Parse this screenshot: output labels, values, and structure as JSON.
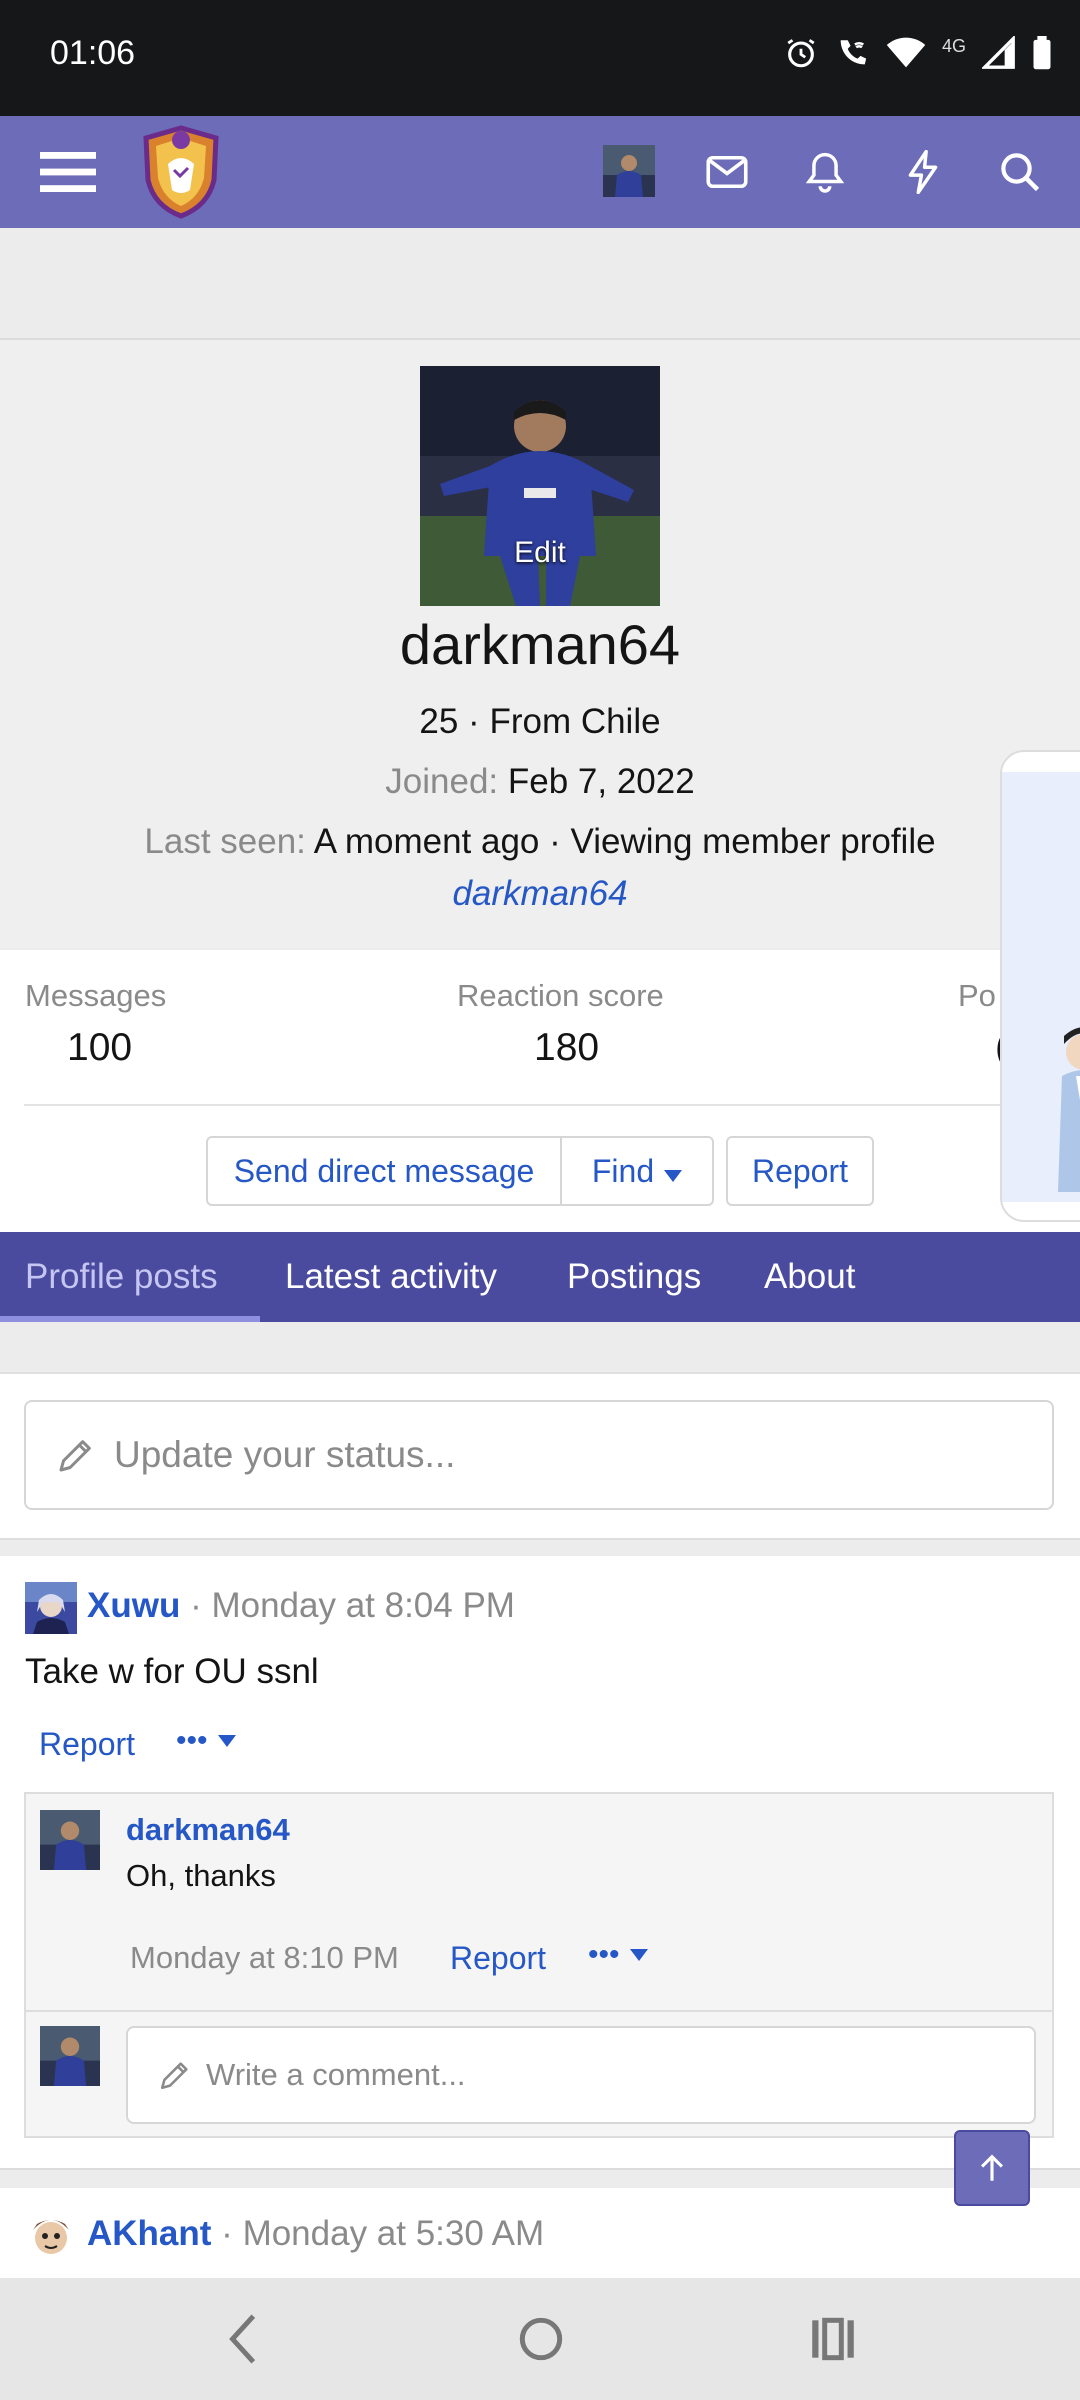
{
  "statusbar": {
    "time": "01:06",
    "network": "4G"
  },
  "header": {
    "icons": [
      "menu-icon",
      "logo",
      "user-avatar",
      "envelope-icon",
      "bell-icon",
      "bolt-icon",
      "search-icon"
    ]
  },
  "profile": {
    "avatar_edit": "Edit",
    "username": "darkman64",
    "age_location": "25 · From Chile",
    "joined_label": "Joined:",
    "joined_value": "Feb 7, 2022",
    "last_seen_label": "Last seen:",
    "last_seen_value": "A moment ago · Viewing member profile",
    "last_seen_link": "darkman64"
  },
  "stats": [
    {
      "label": "Messages",
      "value": "100"
    },
    {
      "label": "Reaction score",
      "value": "180"
    },
    {
      "label": "Po",
      "value": "("
    }
  ],
  "actions": {
    "message": "Send direct message",
    "find": "Find",
    "report": "Report"
  },
  "tabs": [
    "Profile posts",
    "Latest activity",
    "Postings",
    "About"
  ],
  "status_input": {
    "placeholder": "Update your status..."
  },
  "posts": [
    {
      "author": "Xuwu",
      "time": "Monday at 8:04 PM",
      "body": "Take w for OU ssnl",
      "report": "Report",
      "more": "•••",
      "reply": {
        "author": "darkman64",
        "body": "Oh, thanks",
        "time": "Monday at 8:10 PM",
        "report": "Report",
        "more": "•••"
      },
      "comment_placeholder": "Write a comment..."
    },
    {
      "author": "AKhant",
      "time": "Monday at 5:30 AM"
    }
  ],
  "colors": {
    "header": "#6c6cb8",
    "tabs": "#4a4a9e",
    "link": "#2557c6"
  }
}
